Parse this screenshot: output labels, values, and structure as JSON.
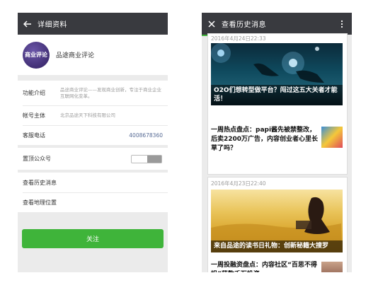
{
  "left": {
    "header": {
      "title": "详细资料"
    },
    "profile": {
      "name": "品途商业评论",
      "avatar_text": "商业评论"
    },
    "info": {
      "function_label": "功能介绍",
      "function_value": "品途商业评论——发现商业创新，专注于商业企业互联网化变革。",
      "account_label": "帐号主体",
      "account_value": "北京品途天下科技有限公司",
      "service_label": "客服电话",
      "service_value": "4008678360"
    },
    "pin": {
      "label": "置顶公众号",
      "enabled": false
    },
    "menu": {
      "history": "查看历史消息",
      "location": "查看地理位置"
    },
    "follow_button": "关注"
  },
  "right": {
    "header": {
      "title": "查看历史消息"
    },
    "articles": [
      {
        "date": "2016年4月24日22:33",
        "headline": "O2O们想转型做平台？闯过这五大关者才能活！",
        "secondary": "一周热点盘点：papi酱先被禁整改，后卖2200万广告，内容创业者心里长草了吗？"
      },
      {
        "date": "2016年4月23日22:40",
        "headline": "来自品途的读书日礼物：创新秘籍大搜罗",
        "secondary": "一周投融资盘点：内容社区“百思不得姐”获数千万投资，"
      }
    ]
  },
  "colors": {
    "appbar": "#393a3f",
    "accent": "#3fb43a",
    "link": "#576b95"
  }
}
